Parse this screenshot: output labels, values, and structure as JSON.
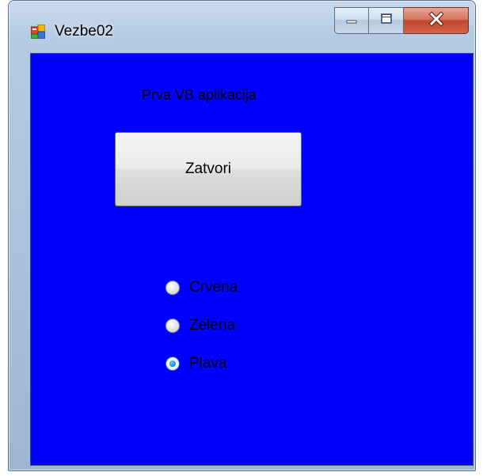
{
  "window": {
    "title": "Vezbe02",
    "background_color": "#0000ff",
    "icon": "app-form-icon"
  },
  "caption_buttons": {
    "minimize": "minimize-icon",
    "maximize": "maximize-icon",
    "close": "close-icon"
  },
  "form": {
    "label_text": "Prva VB aplikacija",
    "button_label": "Zatvori",
    "radio_options": [
      {
        "label": "Crvena",
        "checked": false
      },
      {
        "label": "Zelena",
        "checked": false
      },
      {
        "label": "Plava",
        "checked": true
      }
    ]
  }
}
